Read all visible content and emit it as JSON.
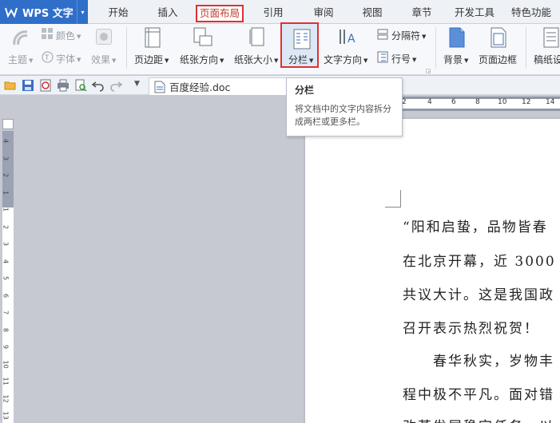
{
  "app": {
    "title": "WPS 文字",
    "menu_caret": "▾"
  },
  "tabs": [
    "开始",
    "插入",
    "页面布局",
    "引用",
    "审阅",
    "视图",
    "章节",
    "开发工具",
    "特色功能"
  ],
  "ribbon": {
    "theme": "主题",
    "colors": "颜色",
    "fonts": "字体",
    "effects": "效果",
    "margins": "页边距",
    "orientation": "纸张方向",
    "size": "纸张大小",
    "columns": "分栏",
    "text_direction": "文字方向",
    "breaks": "分隔符",
    "line_numbers": "行号",
    "background": "背景",
    "page_borders": "页面边框",
    "draft": "稿纸设"
  },
  "document": {
    "tab_name": "百度经验.doc"
  },
  "tooltip": {
    "title": "分栏",
    "body": "将文档中的文字内容拆分成两栏或更多栏。"
  },
  "ruler": {
    "h_numbers": [
      "2",
      "4",
      "6",
      "8",
      "10",
      "12",
      "14"
    ],
    "v_numbers": [
      "4",
      "3",
      "2",
      "1",
      "1",
      "2",
      "3",
      "4",
      "5",
      "6",
      "7",
      "8",
      "9",
      "10",
      "11",
      "12",
      "13"
    ]
  },
  "page_text": [
    "“阳和启蛰，品物皆春",
    "在北京开幕，近 3000",
    "共议大计。这是我国政",
    "召开表示热烈祝贺！",
    "　　春华秋实，岁物丰",
    "程中极不平凡。面对错",
    "改革发展稳定任务，以"
  ],
  "colors": {
    "accent": "#2f6fc9",
    "highlight": "#e03030"
  }
}
